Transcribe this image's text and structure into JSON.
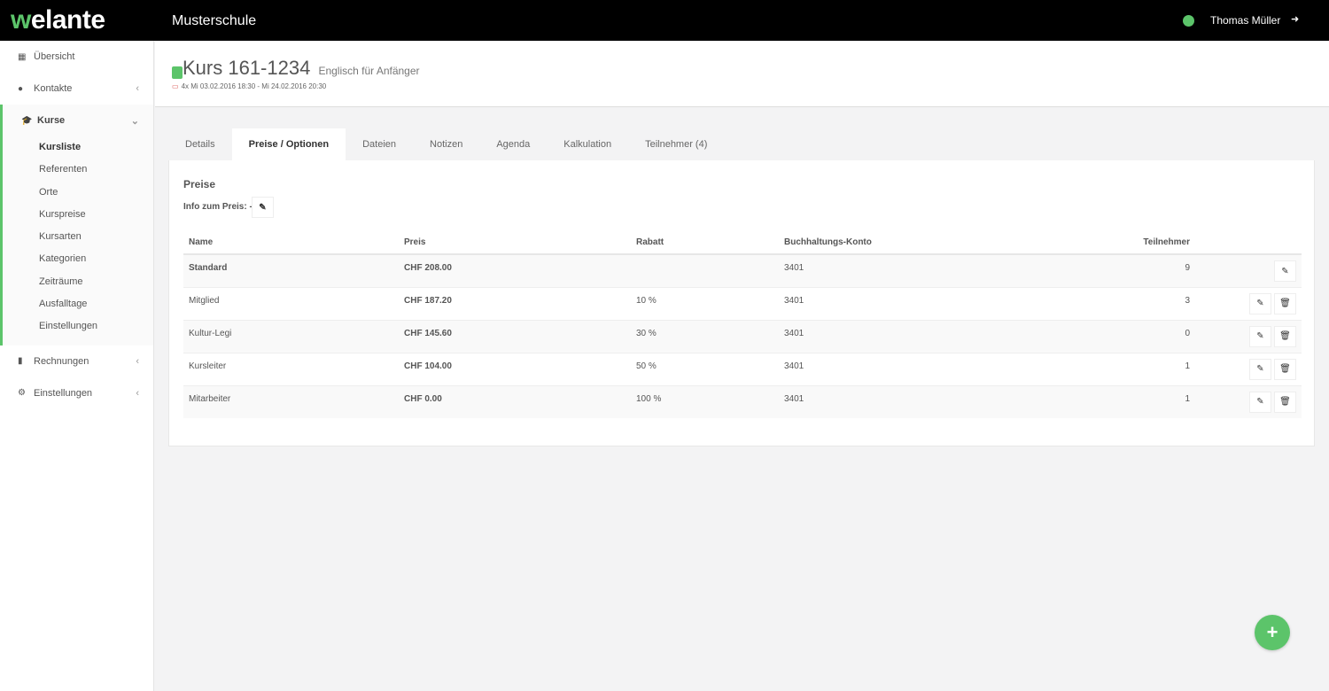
{
  "topbar": {
    "logo": "welante",
    "school": "Musterschule",
    "user": "Thomas Müller"
  },
  "sidebar": {
    "items": [
      {
        "label": "Übersicht",
        "icon": "dashboard-icon"
      },
      {
        "label": "Kontakte",
        "icon": "user-icon"
      },
      {
        "label": "Kurse",
        "icon": "graduation-cap-icon"
      },
      {
        "label": "Rechnungen",
        "icon": "file-icon"
      },
      {
        "label": "Einstellungen",
        "icon": "cogs-icon"
      }
    ],
    "kurse_sub": [
      "Kursliste",
      "Referenten",
      "Orte",
      "Kurspreise",
      "Kursarten",
      "Kategorien",
      "Zeiträume",
      "Ausfalltage",
      "Einstellungen"
    ]
  },
  "header": {
    "title": "Kurs 161-1234",
    "subtitle": "Englisch für Anfänger",
    "dates": "4x Mi 03.02.2016 18:30 - Mi 24.02.2016 20:30"
  },
  "tabs": [
    "Details",
    "Preise / Optionen",
    "Dateien",
    "Notizen",
    "Agenda",
    "Kalkulation",
    "Teilnehmer (4)"
  ],
  "panel": {
    "title": "Preise",
    "info_label": "Info zum Preis:",
    "info_value": "-"
  },
  "table": {
    "headers": [
      "Name",
      "Preis",
      "Rabatt",
      "Buchhaltungs-Konto",
      "Teilnehmer"
    ],
    "rows": [
      [
        "Standard",
        "CHF 208.00",
        "",
        "3401",
        "9"
      ],
      [
        "Mitglied",
        "CHF 187.20",
        "10 %",
        "3401",
        "3"
      ],
      [
        "Kultur-Legi",
        "CHF 145.60",
        "30 %",
        "3401",
        "0"
      ],
      [
        "Kursleiter",
        "CHF 104.00",
        "50 %",
        "3401",
        "1"
      ],
      [
        "Mitarbeiter",
        "CHF 0.00",
        "100 %",
        "3401",
        "1"
      ]
    ]
  },
  "fab": "+",
  "colors": {
    "accent": "#5cc46a"
  }
}
